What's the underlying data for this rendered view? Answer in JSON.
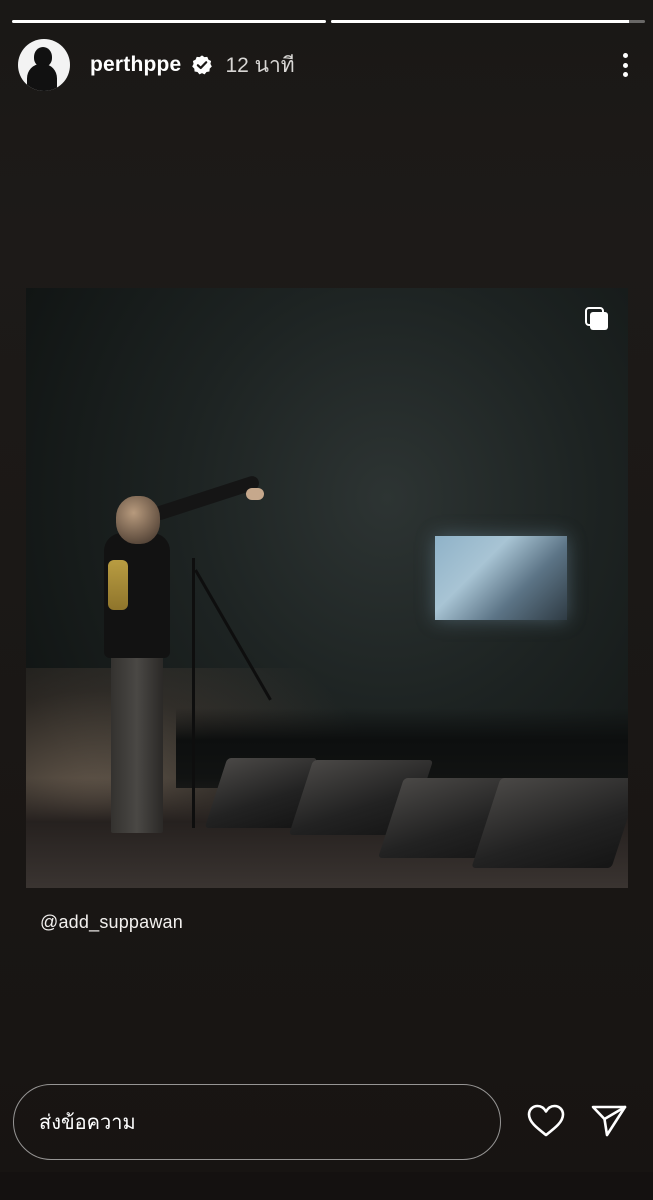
{
  "story": {
    "progress": [
      1.0,
      0.95
    ],
    "username": "perthppe",
    "verified": true,
    "time_ago": "12 นาที"
  },
  "post": {
    "mention": "@add_suppawan",
    "icons": {
      "multi_photo": "carousel-icon"
    }
  },
  "footer": {
    "reply_placeholder": "ส่งข้อความ",
    "like_icon": "heart-icon",
    "send_icon": "send-icon"
  },
  "colors": {
    "background": "#1a1715",
    "text": "#ffffff",
    "verified_badge": "#ffffff"
  }
}
